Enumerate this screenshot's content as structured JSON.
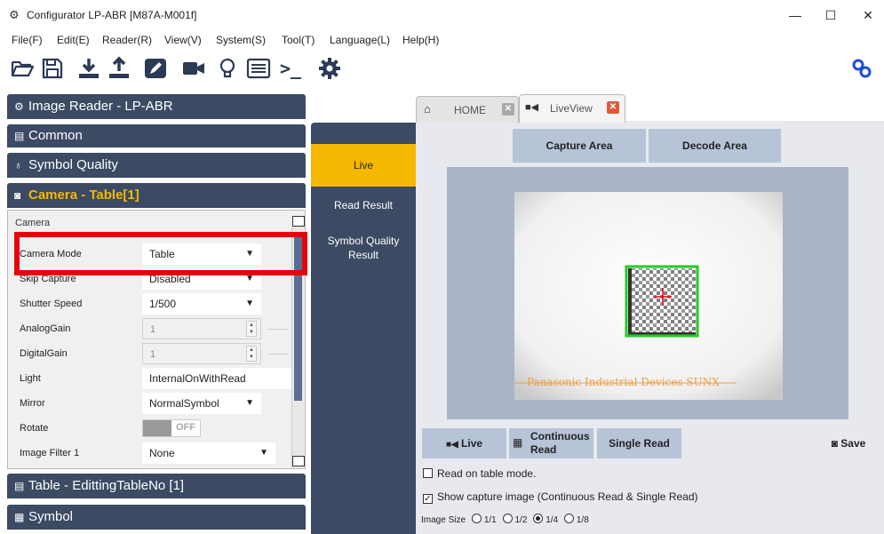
{
  "window": {
    "title": "Configurator LP-ABR [M87A-M001f]",
    "minimize": "—",
    "maximize": "☐",
    "close": "✕"
  },
  "menu": [
    "File(F)",
    "Edit(E)",
    "Reader(R)",
    "View(V)",
    "System(S)",
    "Tool(T)",
    "Language(L)",
    "Help(H)"
  ],
  "toolbar": {
    "icons": [
      "folder-open-icon",
      "save-icon",
      "download-icon",
      "upload-icon",
      "edit-icon",
      "camera-icon",
      "lightbulb-icon",
      "list-icon",
      "terminal-icon",
      "gear-icon"
    ],
    "terminal_glyph": ">_",
    "right_icon": "link-icon"
  },
  "left": {
    "reader_header": "Image Reader - LP-ABR",
    "common": "Common",
    "symbol_quality": "Symbol Quality",
    "camera_table": "Camera - Table[1]",
    "camera_group": "Camera",
    "table_editing": "Table - EdittingTableNo [1]",
    "symbol": "Symbol",
    "rows": [
      {
        "label": "Camera Mode",
        "value": "Table"
      },
      {
        "label": "Skip Capture",
        "value": "Disabled"
      },
      {
        "label": "Shutter Speed",
        "value": "1/500"
      },
      {
        "label": "AnalogGain",
        "value": "1"
      },
      {
        "label": "DigitalGain",
        "value": "1"
      },
      {
        "label": "Light",
        "value": "InternalOnWithRead"
      },
      {
        "label": "Mirror",
        "value": "NormalSymbol"
      },
      {
        "label": "Rotate",
        "value": "OFF"
      },
      {
        "label": "Image Filter 1",
        "value": "None"
      }
    ],
    "highlight_color": "#e8000b"
  },
  "nav": {
    "live": "Live",
    "read_result": "Read Result",
    "symbol_quality_result_1": "Symbol Quality",
    "symbol_quality_result_2": "Result"
  },
  "tabs": {
    "home": "HOME",
    "liveview": "LiveView"
  },
  "right": {
    "capture_area": "Capture Area",
    "decode_area": "Decode Area",
    "watermark": "Panasonic Industrial Devices SUNX",
    "live_btn": "Live",
    "continuous_1": "Continuous",
    "continuous_2": "Read",
    "single_read": "Single Read",
    "save": "Save",
    "read_on_table": "Read on table mode.",
    "show_capture": "Show capture image (Continuous Read & Single Read)",
    "image_size_label": "Image Size",
    "image_sizes": [
      "1/1",
      "1/2",
      "1/4",
      "1/8"
    ],
    "image_size_selected": "1/4"
  },
  "colors": {
    "nav_bg": "#3c4a63",
    "accent": "#f5b800",
    "button": "#b7c4d8",
    "frame": "#a9b4c7",
    "decode_box": "#22cc22",
    "close_tab": "#e05a3a"
  }
}
